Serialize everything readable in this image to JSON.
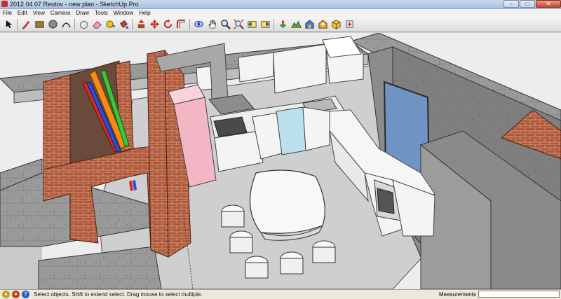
{
  "window": {
    "title": "2012 04 07 Reutov - new plan - SketchUp Pro",
    "controls": {
      "minimize": "–",
      "maximize": "□",
      "close": "✕"
    }
  },
  "menu": [
    "File",
    "Edit",
    "View",
    "Camera",
    "Draw",
    "Tools",
    "Window",
    "Help"
  ],
  "toolbar": {
    "tools": [
      {
        "name": "select-tool",
        "icon": "arrow-cursor-icon"
      },
      {
        "name": "line-tool",
        "icon": "pencil-icon"
      },
      {
        "name": "rectangle-tool",
        "icon": "rectangle-icon"
      },
      {
        "name": "circle-tool",
        "icon": "circle-icon"
      },
      {
        "name": "arc-tool",
        "icon": "arc-icon"
      },
      {
        "name": "make-component-tool",
        "icon": "component-icon"
      },
      {
        "name": "eraser-tool",
        "icon": "eraser-icon"
      },
      {
        "name": "tape-measure-tool",
        "icon": "tape-measure-icon"
      },
      {
        "name": "paint-bucket-tool",
        "icon": "paint-bucket-icon"
      },
      {
        "name": "push-pull-tool",
        "icon": "push-pull-icon"
      },
      {
        "name": "move-tool",
        "icon": "move-icon"
      },
      {
        "name": "rotate-tool",
        "icon": "rotate-icon"
      },
      {
        "name": "offset-tool",
        "icon": "offset-icon"
      },
      {
        "name": "orbit-tool",
        "icon": "orbit-icon"
      },
      {
        "name": "pan-tool",
        "icon": "hand-icon"
      },
      {
        "name": "zoom-tool",
        "icon": "magnifier-icon"
      },
      {
        "name": "zoom-extents-tool",
        "icon": "zoom-extents-icon"
      },
      {
        "name": "previous-view-tool",
        "icon": "previous-view-icon"
      },
      {
        "name": "next-view-tool",
        "icon": "next-view-icon"
      },
      {
        "name": "add-location-tool",
        "icon": "location-icon"
      },
      {
        "name": "toggle-terrain-tool",
        "icon": "terrain-icon"
      },
      {
        "name": "get-models-tool",
        "icon": "warehouse-icon"
      },
      {
        "name": "share-model-tool",
        "icon": "share-icon"
      },
      {
        "name": "components-tool",
        "icon": "components-box-icon"
      },
      {
        "name": "extension-tool",
        "icon": "extension-icon"
      }
    ]
  },
  "status": {
    "message": "Select objects. Shift to extend select. Drag mouse to select multiple.",
    "measurements_label": "Measurements",
    "measurements_value": ""
  },
  "colors": {
    "titlebar": "#b7cbe8",
    "fridge": "#f3b6c4",
    "dishwasher": "#b9e0ec",
    "brick": "#b05a3c",
    "window_glass": "#6f93c4",
    "pipe_red": "#d62b20",
    "pipe_blue": "#2b4fd6",
    "pipe_orange": "#f08c18",
    "pipe_green": "#3cc43a"
  }
}
